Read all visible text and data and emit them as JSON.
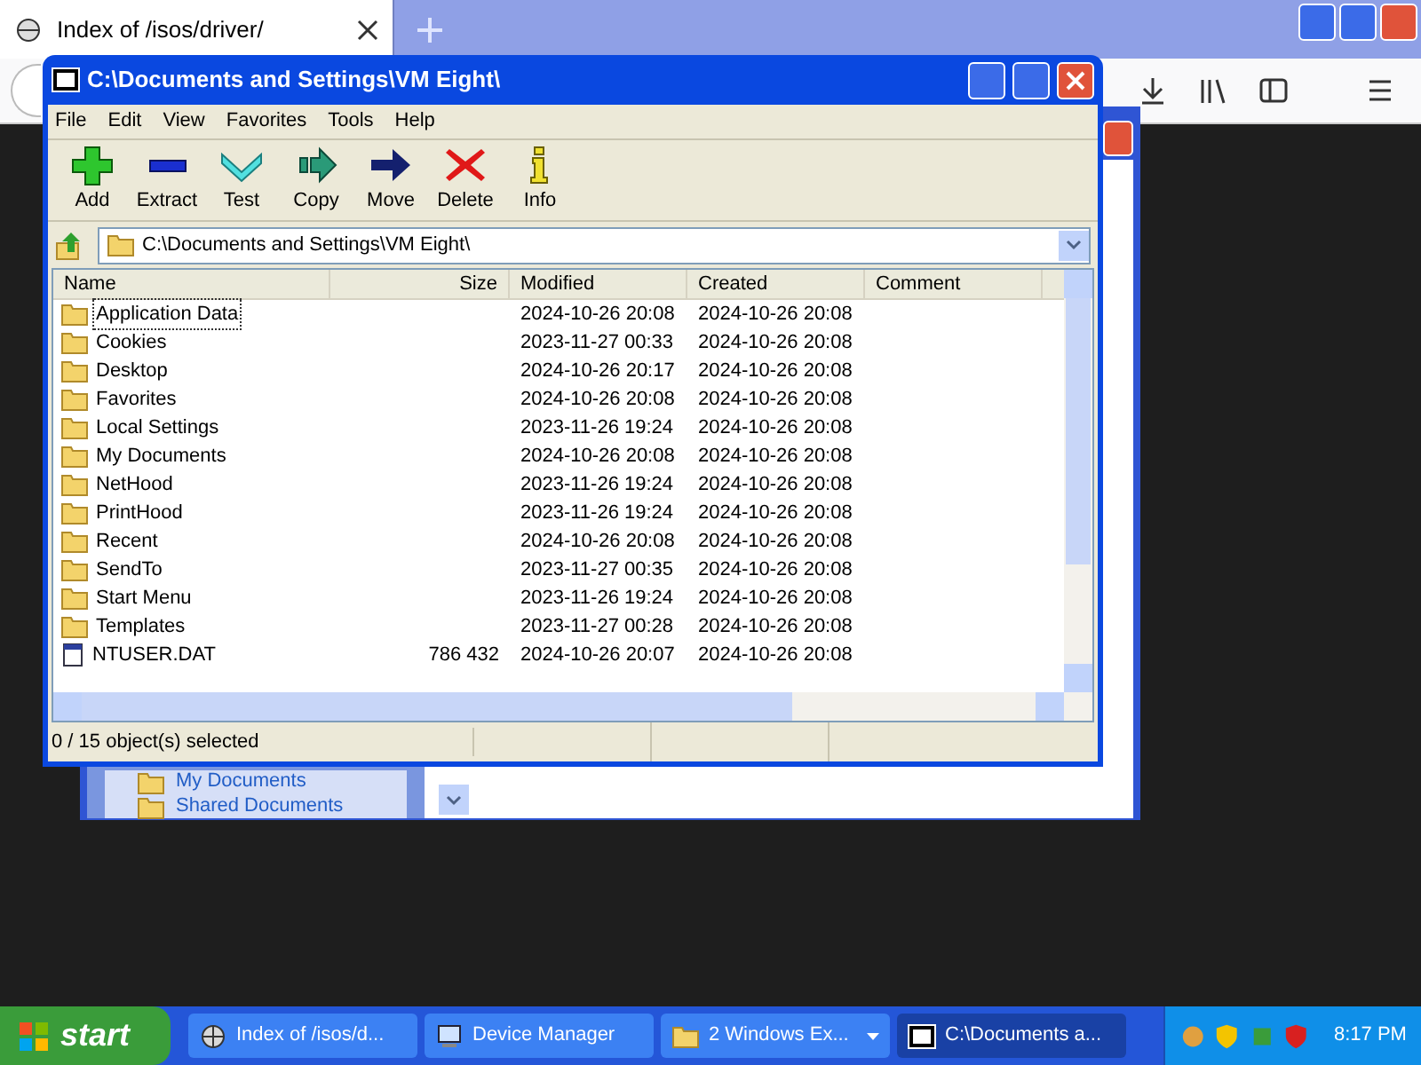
{
  "browser": {
    "tab": {
      "title": "Index of /isos/driver/",
      "selected": true
    }
  },
  "explorer_behind": {
    "sidebar_items": [
      {
        "label": "My Documents"
      },
      {
        "label": "Shared Documents"
      }
    ]
  },
  "archiver": {
    "title": "C:\\Documents and Settings\\VM Eight\\",
    "menu": [
      "File",
      "Edit",
      "View",
      "Favorites",
      "Tools",
      "Help"
    ],
    "toolbar": [
      {
        "label": "Add",
        "kind": "add"
      },
      {
        "label": "Extract",
        "kind": "extract"
      },
      {
        "label": "Test",
        "kind": "test"
      },
      {
        "label": "Copy",
        "kind": "copy"
      },
      {
        "label": "Move",
        "kind": "move"
      },
      {
        "label": "Delete",
        "kind": "delete"
      },
      {
        "label": "Info",
        "kind": "info"
      }
    ],
    "address": "C:\\Documents and Settings\\VM Eight\\",
    "columns": [
      "Name",
      "Size",
      "Modified",
      "Created",
      "Comment"
    ],
    "rows": [
      {
        "name": "Application Data",
        "kind": "folder",
        "size": "",
        "modified": "2024-10-26 20:08",
        "created": "2024-10-26 20:08",
        "focused": true
      },
      {
        "name": "Cookies",
        "kind": "folder",
        "size": "",
        "modified": "2023-11-27 00:33",
        "created": "2024-10-26 20:08",
        "focused": false
      },
      {
        "name": "Desktop",
        "kind": "folder",
        "size": "",
        "modified": "2024-10-26 20:17",
        "created": "2024-10-26 20:08",
        "focused": false
      },
      {
        "name": "Favorites",
        "kind": "folder",
        "size": "",
        "modified": "2024-10-26 20:08",
        "created": "2024-10-26 20:08",
        "focused": false
      },
      {
        "name": "Local Settings",
        "kind": "folder",
        "size": "",
        "modified": "2023-11-26 19:24",
        "created": "2024-10-26 20:08",
        "focused": false
      },
      {
        "name": "My Documents",
        "kind": "folder",
        "size": "",
        "modified": "2024-10-26 20:08",
        "created": "2024-10-26 20:08",
        "focused": false
      },
      {
        "name": "NetHood",
        "kind": "folder",
        "size": "",
        "modified": "2023-11-26 19:24",
        "created": "2024-10-26 20:08",
        "focused": false
      },
      {
        "name": "PrintHood",
        "kind": "folder",
        "size": "",
        "modified": "2023-11-26 19:24",
        "created": "2024-10-26 20:08",
        "focused": false
      },
      {
        "name": "Recent",
        "kind": "folder",
        "size": "",
        "modified": "2024-10-26 20:08",
        "created": "2024-10-26 20:08",
        "focused": false
      },
      {
        "name": "SendTo",
        "kind": "folder",
        "size": "",
        "modified": "2023-11-27 00:35",
        "created": "2024-10-26 20:08",
        "focused": false
      },
      {
        "name": "Start Menu",
        "kind": "folder",
        "size": "",
        "modified": "2023-11-26 19:24",
        "created": "2024-10-26 20:08",
        "focused": false
      },
      {
        "name": "Templates",
        "kind": "folder",
        "size": "",
        "modified": "2023-11-27 00:28",
        "created": "2024-10-26 20:08",
        "focused": false
      },
      {
        "name": "NTUSER.DAT",
        "kind": "file",
        "size": "786 432",
        "modified": "2024-10-26 20:07",
        "created": "2024-10-26 20:08",
        "focused": false
      }
    ],
    "status": "0 / 15 object(s) selected"
  },
  "taskbar": {
    "start": "start",
    "buttons": [
      {
        "label": "Index of /isos/d...",
        "kind": "browser",
        "grouped": false,
        "selected": false
      },
      {
        "label": "Device Manager",
        "kind": "device",
        "grouped": false,
        "selected": false
      },
      {
        "label": "2 Windows Ex...",
        "kind": "folder",
        "grouped": true,
        "selected": false
      },
      {
        "label": "C:\\Documents a...",
        "kind": "archiver",
        "grouped": false,
        "selected": true
      }
    ],
    "clock": "8:17 PM"
  }
}
